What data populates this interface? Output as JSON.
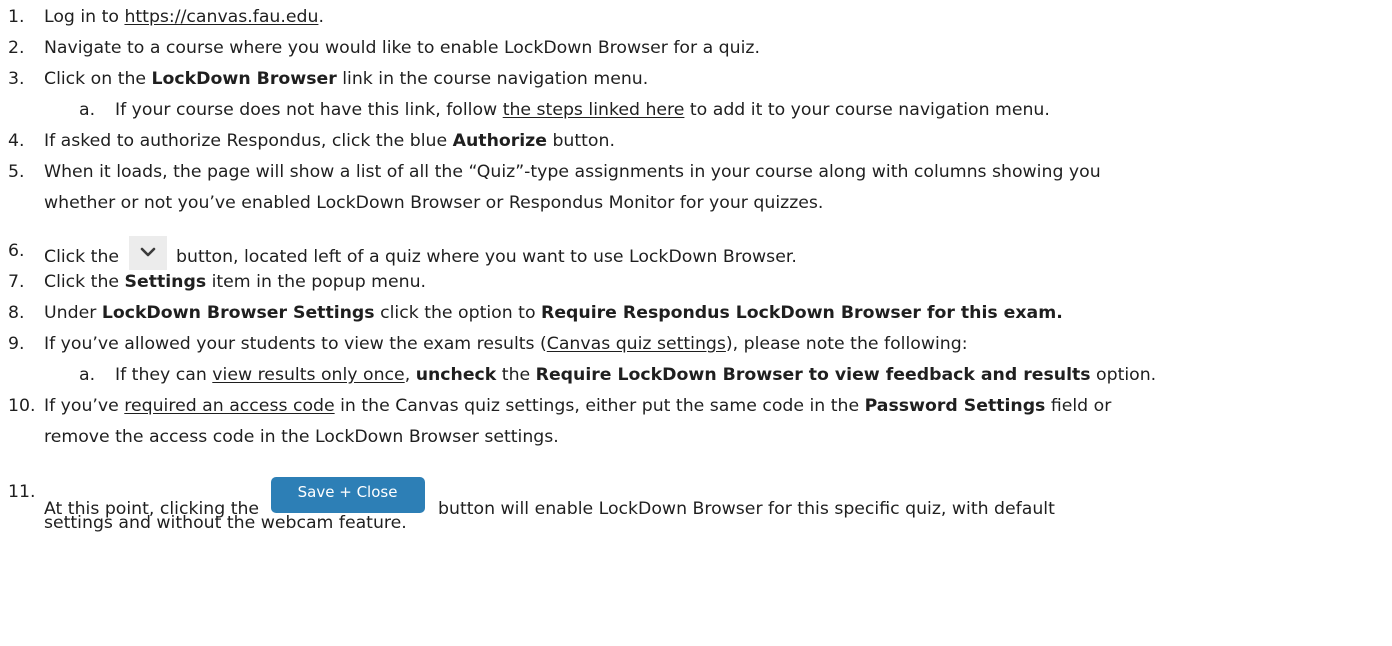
{
  "steps": [
    {
      "num": "1.",
      "pre": "Log in to ",
      "link": "https://canvas.fau.edu",
      "post": "."
    },
    {
      "num": "2.",
      "text": "Navigate to a course where you would like to enable LockDown Browser for a quiz."
    },
    {
      "num": "3.",
      "pre": "Click on the ",
      "bold": "LockDown Browser",
      "post": " link in the course navigation menu."
    },
    {
      "num": "a.",
      "pre": "If your course does not have this link, follow ",
      "link": "the steps linked here",
      "post": " to add it to your course navigation menu."
    },
    {
      "num": "4.",
      "pre": "If asked to authorize Respondus, click the blue ",
      "bold": "Authorize",
      "post": " button."
    },
    {
      "num": "5.",
      "line1": "When it loads, the page will show a list of all the “Quiz”-type assignments in your course along with columns showing you",
      "line2": "whether or not you’ve enabled LockDown Browser or Respondus Monitor for your quizzes."
    },
    {
      "num": "6.",
      "pre": "Click the ",
      "post": " button, located left of a quiz where you want to use LockDown Browser."
    },
    {
      "num": "7.",
      "pre": "Click the ",
      "bold": "Settings",
      "post": " item in the popup menu."
    },
    {
      "num": "8.",
      "pre": "Under ",
      "bold1": "LockDown Browser Settings",
      "mid": " click the option to ",
      "bold2": "Require Respondus LockDown Browser for this exam."
    },
    {
      "num": "9.",
      "pre": "If you’ve allowed your students to view the exam results (",
      "link": "Canvas quiz settings",
      "post": "), please note the following:"
    },
    {
      "num": "a.",
      "pre": "If they can ",
      "link": "view results only once",
      "mid1": ", ",
      "bold1": "uncheck",
      "mid2": " the ",
      "bold2": "Require LockDown Browser to view feedback and results",
      "post": " option."
    },
    {
      "num": "10.",
      "pre": "If you’ve ",
      "link": "required an access code",
      "mid": " in the Canvas quiz settings, either put the same code in the ",
      "bold": "Password Settings",
      "post": " field or",
      "line2": "remove the access code in the LockDown Browser settings."
    },
    {
      "num": "11.",
      "pre": "At this point, clicking the ",
      "button": "Save + Close",
      "post": " button will enable LockDown Browser for this specific quiz, with default",
      "line2": "settings and without the webcam feature."
    }
  ],
  "icons": {
    "dropdown": "chevron-down-icon"
  },
  "colors": {
    "save_button": "#2d7fb6",
    "chevron_button": "#ececec"
  }
}
